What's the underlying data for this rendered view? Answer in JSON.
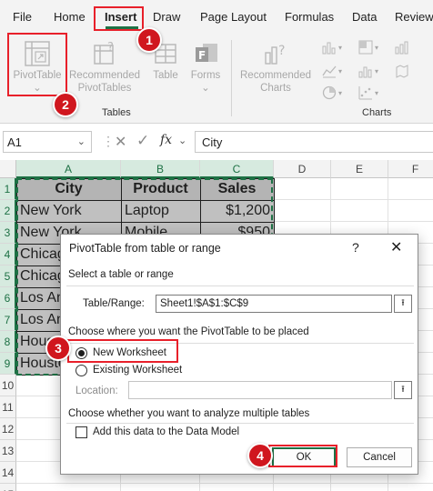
{
  "menu": {
    "tabs": [
      {
        "label": "File"
      },
      {
        "label": "Home"
      },
      {
        "label": "Insert"
      },
      {
        "label": "Draw"
      },
      {
        "label": "Page Layout"
      },
      {
        "label": "Formulas"
      },
      {
        "label": "Data"
      },
      {
        "label": "Review"
      }
    ],
    "active_tab": "Insert"
  },
  "ribbon": {
    "tables_group": {
      "label": "Tables",
      "pivottable": "PivotTable",
      "recommended_pivot_1": "Recommended",
      "recommended_pivot_2": "PivotTables",
      "table": "Table",
      "forms": "Forms"
    },
    "charts_group": {
      "label": "Charts",
      "recommended_charts_1": "Recommended",
      "recommended_charts_2": "Charts"
    }
  },
  "formula_bar": {
    "name_box": "A1",
    "fx": "fx",
    "content": "City"
  },
  "grid": {
    "columns": [
      "A",
      "B",
      "C",
      "D",
      "E",
      "F"
    ],
    "rows": [
      "1",
      "2",
      "3",
      "4",
      "5",
      "6",
      "7",
      "8",
      "9",
      "10",
      "11",
      "12",
      "13",
      "14",
      "15"
    ],
    "table": {
      "headers": [
        "City",
        "Product",
        "Sales"
      ],
      "rows": [
        [
          "New York",
          "Laptop",
          "$1,200"
        ],
        [
          "New York",
          "Mobile",
          "$950"
        ],
        [
          "Chicago",
          "",
          ""
        ],
        [
          "Chicago",
          "",
          ""
        ],
        [
          "Los Angeles",
          "",
          ""
        ],
        [
          "Los Angeles",
          "",
          ""
        ],
        [
          "Houston",
          "",
          ""
        ],
        [
          "Houston",
          "",
          ""
        ]
      ]
    }
  },
  "dialog": {
    "title": "PivotTable from table or range",
    "help": "?",
    "close": "✕",
    "section_select": "Select a table or range",
    "range_label": "Table/Range:",
    "range_value": "Sheet1!$A$1:$C$9",
    "section_place": "Choose where you want the PivotTable to be placed",
    "new_worksheet": "New Worksheet",
    "existing_worksheet": "Existing Worksheet",
    "location_label": "Location:",
    "location_value": "",
    "section_multi": "Choose whether you want to analyze multiple tables",
    "data_model": "Add this data to the Data Model",
    "ok": "OK",
    "cancel": "Cancel"
  },
  "callouts": [
    "1",
    "2",
    "3",
    "4"
  ],
  "colors": {
    "excel_green": "#1e7145",
    "callout_red": "#d0161e",
    "header_fill": "#b4b4b4",
    "data_fill": "#c0c0c0"
  }
}
